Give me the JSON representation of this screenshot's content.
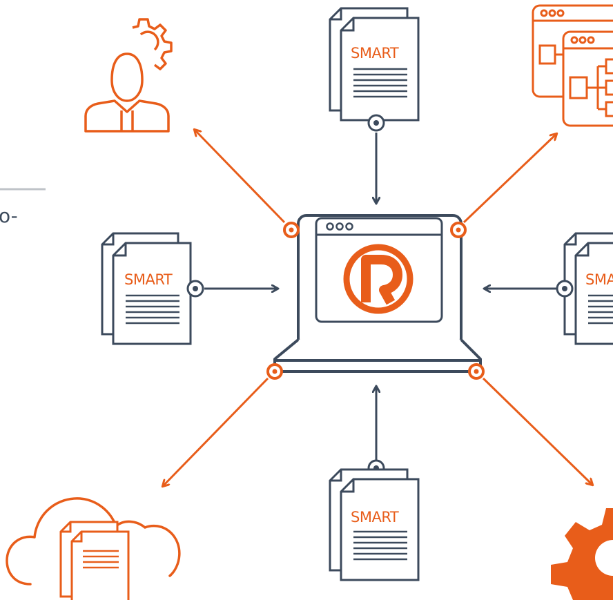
{
  "colors": {
    "primary": "#3c4a5c",
    "accent": "#e85d1a",
    "background": "#ffffff",
    "divider": "#bfc3c8"
  },
  "cropped_text": "o-",
  "center": {
    "window_controls": "ooo",
    "logo_icon": "registered-r-icon"
  },
  "documents": {
    "label": "SMART",
    "top_label": "SMART",
    "left_label": "SMART",
    "right_label": "SMA",
    "bottom_label": "SMART"
  },
  "icons": {
    "top_left": "user-gear-icon",
    "top_right": "app-windows-flowchart-icon",
    "bottom_left": "cloud-documents-icon",
    "bottom_right": "gear-icon"
  },
  "top_right_window_controls": [
    "ooo",
    "ooo"
  ]
}
